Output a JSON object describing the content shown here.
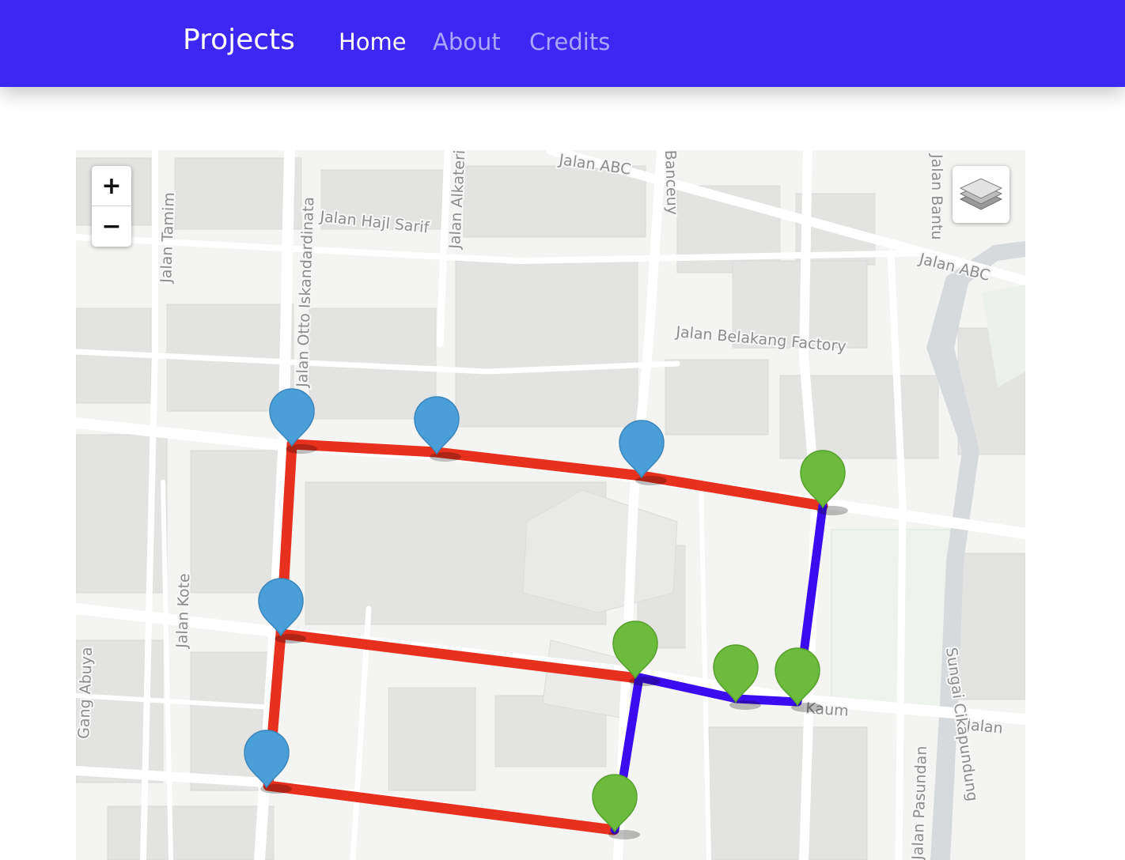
{
  "navbar": {
    "brand": "Projects",
    "links": [
      "Home",
      "About",
      "Credits"
    ],
    "background_color": "#3c28f2"
  },
  "map": {
    "zoom_in_label": "+",
    "zoom_out_label": "−",
    "layers_control_icon": "layers-icon",
    "street_labels": [
      "Jalan ABC",
      "Jalan Hajl Sarif",
      "Jalan Alkateri",
      "Jalan Otto Iskandardinata",
      "Jalan Tamim",
      "Jalan Belakang Factory",
      "Jalan ABC",
      "Jalan Bantu",
      "Jalan Kote",
      "Gang Abuya",
      "Kaum",
      "Jalan",
      "Sungai Cikapundung",
      "Jalan Pasundan",
      "Banceuy"
    ],
    "route_colors": {
      "walking": "#e8301e",
      "transit": "#3c0cf0"
    },
    "marker_colors": {
      "stop": "#4b9fd9",
      "transfer": "#6cbb3c"
    }
  }
}
